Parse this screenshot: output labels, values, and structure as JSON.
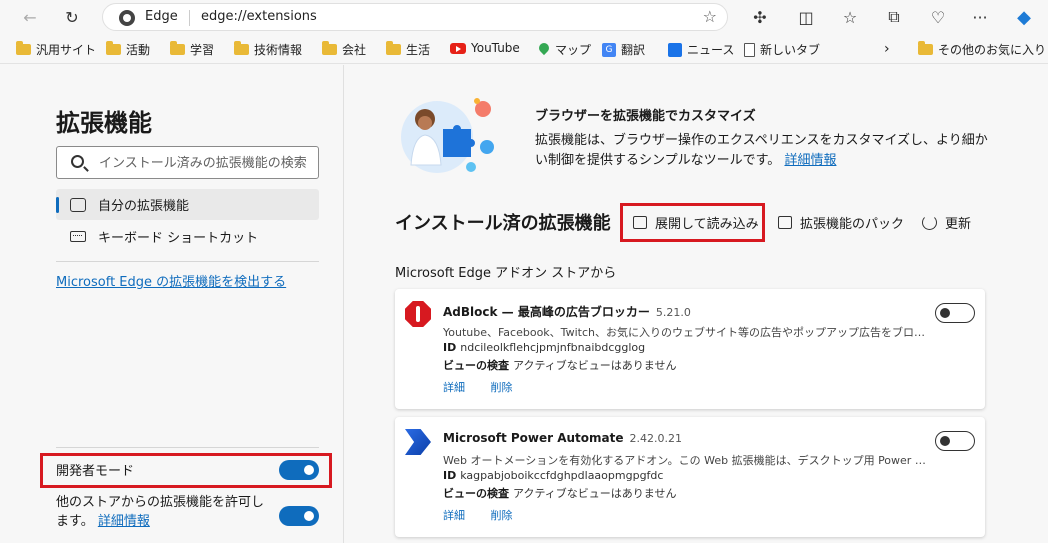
{
  "browser": {
    "brand": "Edge",
    "url": "edge://extensions"
  },
  "bookmarks": [
    {
      "label": "汎用サイト",
      "icon": "folder-icon"
    },
    {
      "label": "活動",
      "icon": "folder-icon"
    },
    {
      "label": "学習",
      "icon": "folder-icon"
    },
    {
      "label": "技術情報",
      "icon": "folder-icon"
    },
    {
      "label": "会社",
      "icon": "folder-icon"
    },
    {
      "label": "生活",
      "icon": "folder-icon"
    },
    {
      "label": "YouTube",
      "icon": "youtube-icon"
    },
    {
      "label": "マップ",
      "icon": "maps-icon"
    },
    {
      "label": "翻訳",
      "icon": "translate-icon"
    },
    {
      "label": "ニュース",
      "icon": "news-icon"
    },
    {
      "label": "新しいタブ",
      "icon": "page-icon"
    },
    {
      "label": "その他のお気に入り",
      "icon": "folder-icon"
    }
  ],
  "sidebar": {
    "title": "拡張機能",
    "search_placeholder": "インストール済みの拡張機能の検索",
    "nav": [
      {
        "label": "自分の拡張機能"
      },
      {
        "label": "キーボード ショートカット"
      }
    ],
    "discover_link": "Microsoft Edge の拡張機能を検出する",
    "developer_mode_label": "開発者モード",
    "developer_mode_on": true,
    "other_stores_text": "他のストアからの拡張機能を許可します。",
    "other_stores_link": "詳細情報",
    "other_stores_on": true
  },
  "main": {
    "hero_title": "ブラウザーを拡張機能でカスタマイズ",
    "hero_desc": "拡張機能は、ブラウザー操作のエクスペリエンスをカスタマイズし、より細かい制御を提供するシンプルなツールです。",
    "hero_link": "詳細情報",
    "installed_title": "インストール済の拡張機能",
    "actions": {
      "load_unpacked": "展開して読み込み",
      "pack": "拡張機能のパック",
      "refresh": "更新"
    },
    "source_label": "Microsoft Edge アドオン ストアから",
    "extensions": [
      {
        "name": "AdBlock — 最高峰の広告ブロッカー",
        "version": "5.21.0",
        "description": "Youtube、Facebook、Twitch、お気に入りのウェブサイト等の広告やポップアップ広告をブロックしましょう。",
        "id_label": "ID",
        "id": "ndcileolkflehcjpmjnfbnaibdcgglog",
        "inspect_label": "ビューの検査",
        "inspect_value": "アクティブなビューはありません",
        "details": "詳細",
        "remove": "削除",
        "enabled": false
      },
      {
        "name": "Microsoft Power Automate",
        "version": "2.42.0.21",
        "description": "Web オートメーションを有効化するアドオン。この Web 拡張機能は、デスクトップ用 Power Automate ...",
        "id_label": "ID",
        "id": "kagpabjoboikccfdghpdlaaopmgpgfdc",
        "inspect_label": "ビューの検査",
        "inspect_value": "アクティブなビューはありません",
        "details": "詳細",
        "remove": "削除",
        "enabled": false
      }
    ]
  },
  "colors": {
    "accent": "#0f6cbd",
    "highlight": "#d71920"
  }
}
